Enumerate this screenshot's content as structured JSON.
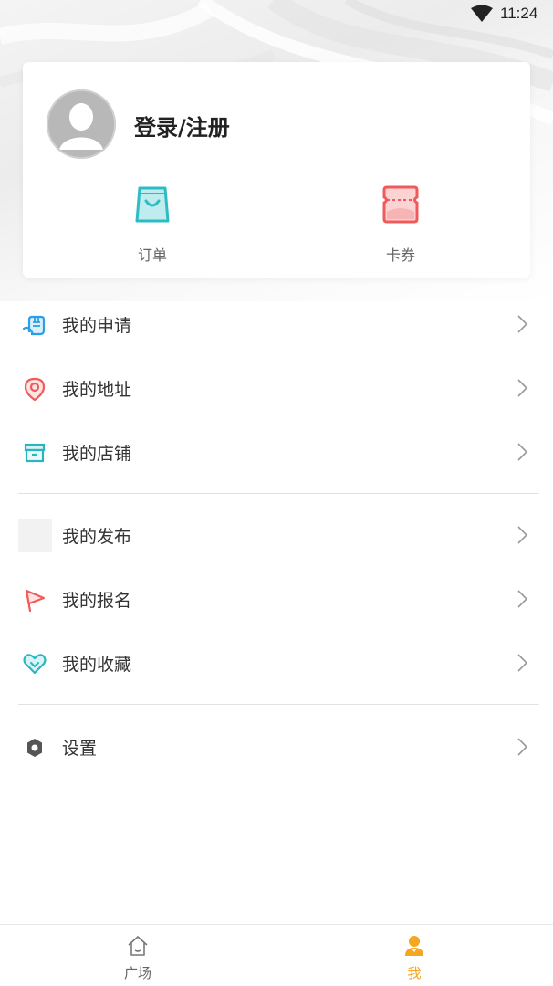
{
  "status_bar": {
    "time": "11:24"
  },
  "profile": {
    "login_label": "登录/注册"
  },
  "quick_actions": [
    {
      "label": "订单",
      "icon": "shopping-bag-icon",
      "color": "#2bbcc4"
    },
    {
      "label": "卡券",
      "icon": "ticket-icon",
      "color": "#f05a5a"
    }
  ],
  "menu": {
    "group1": [
      {
        "label": "我的申请",
        "icon": "hand-icon",
        "color": "#2a9ee6"
      },
      {
        "label": "我的地址",
        "icon": "location-pin-icon",
        "color": "#f05a5a"
      },
      {
        "label": "我的店铺",
        "icon": "store-box-icon",
        "color": "#2bb5c0"
      }
    ],
    "group2": [
      {
        "label": "我的发布",
        "icon": "publish-icon-placeholder",
        "color": "#f2f2f2"
      },
      {
        "label": "我的报名",
        "icon": "flag-icon",
        "color": "#f05a5a"
      },
      {
        "label": "我的收藏",
        "icon": "heart-icon",
        "color": "#2bb5c0"
      }
    ],
    "group3": [
      {
        "label": "设置",
        "icon": "settings-hexagon-icon",
        "color": "#555555"
      }
    ]
  },
  "tabbar": {
    "tabs": [
      {
        "label": "广场",
        "icon": "home-icon",
        "active": false
      },
      {
        "label": "我",
        "icon": "user-icon",
        "active": true
      }
    ],
    "active_color": "#f5a623",
    "inactive_color": "#666666"
  }
}
